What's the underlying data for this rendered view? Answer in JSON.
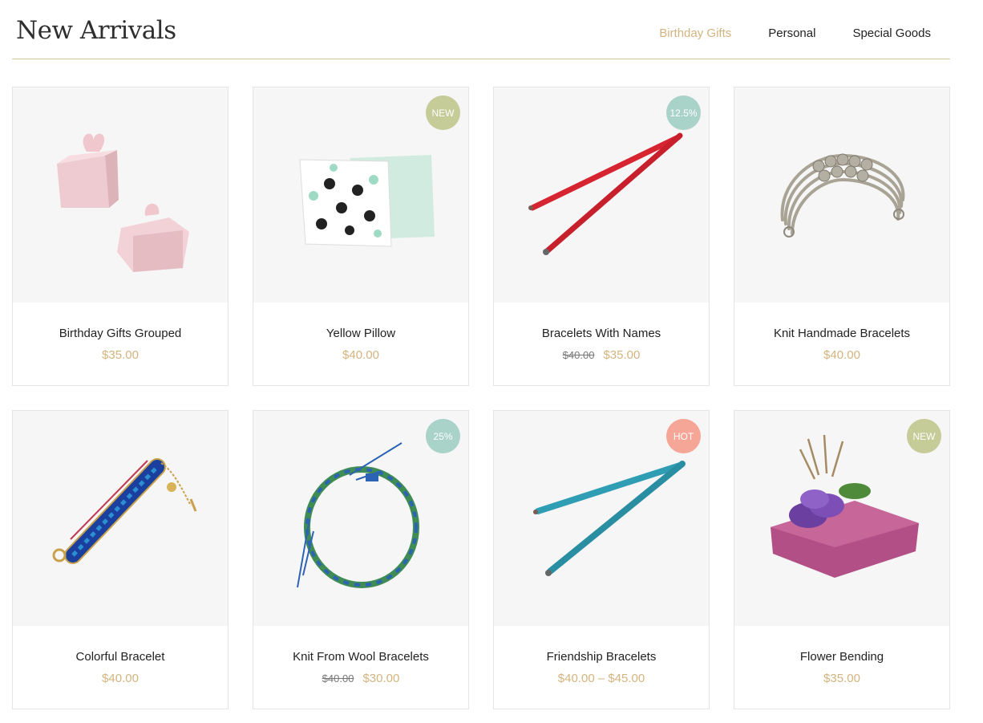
{
  "header": {
    "title": "New Arrivals",
    "tabs": [
      {
        "label": "Birthday Gifts",
        "active": true
      },
      {
        "label": "Personal",
        "active": false
      },
      {
        "label": "Special Goods",
        "active": false
      }
    ]
  },
  "colors": {
    "accent": "#d3b47f",
    "badge_new": "#c5cc98",
    "badge_sale": "#a9d2c8",
    "badge_hot": "#f5a696"
  },
  "products": [
    {
      "name": "Birthday Gifts Grouped",
      "price": "$35.00",
      "badge": null,
      "image": "pink-gift-boxes"
    },
    {
      "name": "Yellow Pillow",
      "price": "$40.00",
      "badge": "NEW",
      "image": "hexagon-pillows"
    },
    {
      "name": "Bracelets With Names",
      "old_price": "$40.00",
      "price": "$35.00",
      "badge": "12.5%",
      "image": "red-cord-bracelet"
    },
    {
      "name": "Knit Handmade Bracelets",
      "price": "$40.00",
      "badge": null,
      "image": "silver-cuff-bracelet"
    },
    {
      "name": "Colorful Bracelet",
      "price": "$40.00",
      "badge": null,
      "image": "beaded-blue-bracelet"
    },
    {
      "name": "Knit From Wool Bracelets",
      "old_price": "$40.00",
      "price": "$30.00",
      "badge": "25%",
      "image": "woven-wool-bracelet"
    },
    {
      "name": "Friendship Bracelets",
      "price": "$40.00 – $45.00",
      "badge": "HOT",
      "image": "teal-cord-bracelet"
    },
    {
      "name": "Flower Bending",
      "price": "$35.00",
      "badge": "NEW",
      "image": "lavender-soap-bar"
    }
  ]
}
